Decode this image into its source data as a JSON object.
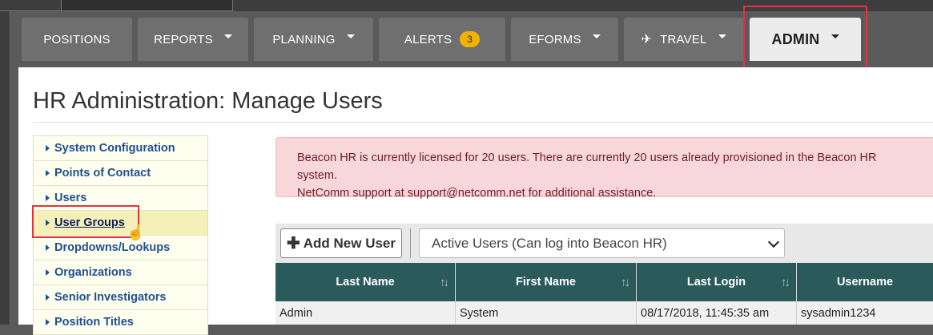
{
  "nav": {
    "tabs": [
      {
        "label": "POSITIONS"
      },
      {
        "label": "REPORTS"
      },
      {
        "label": "PLANNING"
      },
      {
        "label": "ALERTS",
        "badge": "3"
      },
      {
        "label": "EFORMS"
      },
      {
        "label": "TRAVEL"
      },
      {
        "label": "ADMIN"
      }
    ]
  },
  "page": {
    "title": "HR Administration: Manage Users"
  },
  "menu": {
    "items": [
      {
        "label": "System Configuration"
      },
      {
        "label": "Points of Contact"
      },
      {
        "label": "Users"
      },
      {
        "label": "User Groups"
      },
      {
        "label": "Dropdowns/Lookups"
      },
      {
        "label": "Organizations"
      },
      {
        "label": "Senior Investigators"
      },
      {
        "label": "Position Titles"
      }
    ]
  },
  "alert": {
    "line1": "Beacon HR is currently licensed for 20 users. There are currently 20 users already provisioned in the Beacon HR system.",
    "line2": "NetComm support at support@netcomm.net for additional assistance."
  },
  "toolbar": {
    "add_label": "Add New User",
    "filter_selected": "Active Users (Can log into Beacon HR)"
  },
  "table": {
    "headers": [
      "Last Name",
      "First Name",
      "Last Login",
      "Username"
    ],
    "rows": [
      [
        "Admin",
        "System",
        "08/17/2018, 11:45:35 am",
        "sysadmin1234"
      ]
    ]
  },
  "colors": {
    "tab_bg": "#6f6f6f",
    "table_header": "#2b5a5a",
    "alert_bg": "#f8d7da",
    "badge": "#f0b400",
    "highlight": "#e0353f"
  }
}
